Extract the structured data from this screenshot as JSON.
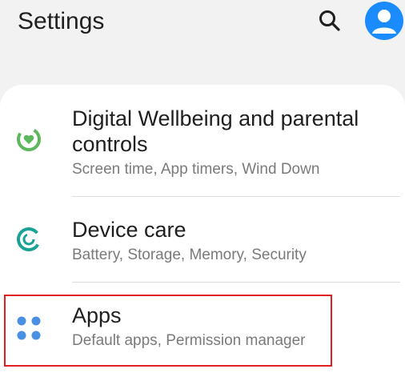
{
  "header": {
    "title": "Settings",
    "search_icon": "search-icon",
    "avatar_icon": "account-icon",
    "avatar_color": "#1a8cff"
  },
  "items": [
    {
      "title_line1": "Digital Wellbeing and parental",
      "title_line2": "controls",
      "subtitle": "Screen time, App timers, Wind Down",
      "icon": "digital-wellbeing-icon",
      "icon_color": "#5cb85c"
    },
    {
      "title": "Device care",
      "subtitle": "Battery, Storage, Memory, Security",
      "icon": "device-care-icon",
      "icon_color": "#1aa394"
    },
    {
      "title": "Apps",
      "subtitle": "Default apps, Permission manager",
      "icon": "apps-icon",
      "icon_color": "#4a90e2"
    }
  ],
  "highlight_color": "#e02020"
}
